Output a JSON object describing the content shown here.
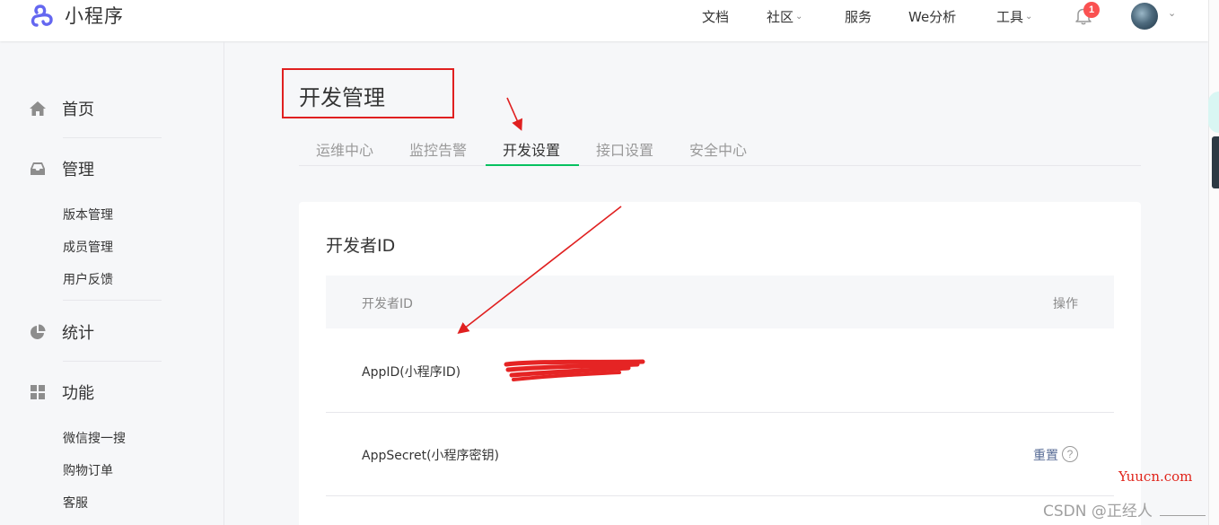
{
  "app": {
    "name": "小程序"
  },
  "nav": {
    "docs": "文档",
    "community": "社区",
    "service": "服务",
    "analytics": "We分析",
    "tools": "工具",
    "notification_count": "1"
  },
  "sidebar": {
    "home": "首页",
    "manage": "管理",
    "manage_items": [
      "版本管理",
      "成员管理",
      "用户反馈"
    ],
    "stats": "统计",
    "features": "功能",
    "feature_items": [
      "微信搜一搜",
      "购物订单",
      "客服"
    ]
  },
  "page": {
    "title": "开发管理",
    "tabs": [
      "运维中心",
      "监控告警",
      "开发设置",
      "接口设置",
      "安全中心"
    ],
    "active_tab": "开发设置"
  },
  "developer_id": {
    "section_title": "开发者ID",
    "columns": [
      "开发者ID",
      "操作"
    ],
    "rows": [
      {
        "label": "AppID(小程序ID)",
        "value": "",
        "action": ""
      },
      {
        "label": "AppSecret(小程序密钥)",
        "value": "",
        "action": "重置"
      }
    ],
    "help": "?"
  },
  "watermark": {
    "site": "Yuucn.com",
    "author": "CSDN @正经人"
  },
  "colors": {
    "accent_green": "#07c160",
    "annotation_red": "#e02020",
    "link_blue": "#576b95",
    "badge_red": "#fa5151"
  }
}
